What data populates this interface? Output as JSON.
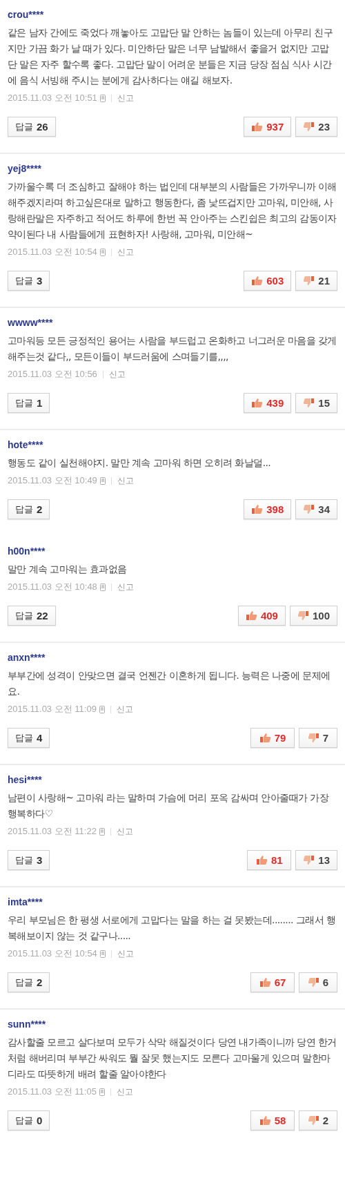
{
  "comments": [
    {
      "user": "crou****",
      "text": "같은 남자 간에도 죽었다 깨놓아도 고맙단 말 안하는 놈들이 있는데 아무리 친구지만 가끔 화가 날 때가 있다. 미안하단 말은 너무 남발해서 좋을거 없지만 고맙단 말은 자주 할수록 좋다. 고맙단 말이 어려운 분들은 지금 당장 점심 식사 시간에 음식 서빙해 주시는 분에게 감사하다는 얘길 해보자.",
      "date": "2015.11.03 오전 10:51",
      "mobile": true,
      "report": "신고",
      "reply_label": "답글",
      "reply_count": "26",
      "likes": "937",
      "dislikes": "23",
      "divider": true
    },
    {
      "user": "yej8****",
      "text": "가까울수록 더 조심하고 잘해야 하는 법인데 대부분의 사람들은 가까우니까 이해해주겠지라며 하고싶은대로 말하고 행동한다, 좀 낯뜨겁지만 고마워, 미안해, 사랑해란말은 자주하고 적어도 하루에 한번 꼭 안아주는 스킨쉽은 최고의 감동이자 약이된다 내 사람들에게 표현하자! 사랑해, 고마워, 미안해~",
      "date": "2015.11.03 오전 10:54",
      "mobile": true,
      "report": "신고",
      "reply_label": "답글",
      "reply_count": "3",
      "likes": "603",
      "dislikes": "21",
      "divider": true
    },
    {
      "user": "wwww****",
      "text": "고마워등 모든 긍정적인 용어는 사람을 부드럽고 온화하고 너그러운 마음을 갖게 해주는것 같다,, 모든이들이 부드러움에 스며들기를,,,,",
      "date": "2015.11.03 오전 10:56",
      "mobile": false,
      "report": "신고",
      "reply_label": "답글",
      "reply_count": "1",
      "likes": "439",
      "dislikes": "15",
      "divider": true
    },
    {
      "user": "hote****",
      "text": "행동도 같이 실천해야지. 말만 계속 고마워 하면 오히려 화날덜...",
      "date": "2015.11.03 오전 10:49",
      "mobile": true,
      "report": "신고",
      "reply_label": "답글",
      "reply_count": "2",
      "likes": "398",
      "dislikes": "34",
      "divider": false
    },
    {
      "user": "h00n****",
      "text": "말만 계속 고마워는 효과없음",
      "date": "2015.11.03 오전 10:48",
      "mobile": true,
      "report": "신고",
      "reply_label": "답글",
      "reply_count": "22",
      "likes": "409",
      "dislikes": "100",
      "divider": true
    },
    {
      "user": "anxn****",
      "text": "부부간에 성격이 안맞으면 결국 언젠간 이혼하게 됩니다. 능력은 나중에 문제에요.",
      "date": "2015.11.03 오전 11:09",
      "mobile": true,
      "report": "신고",
      "reply_label": "답글",
      "reply_count": "4",
      "likes": "79",
      "dislikes": "7",
      "divider": true
    },
    {
      "user": "hesi****",
      "text": "남편이 사랑해~ 고마워 라는 말하며 가슴에 머리 포옥 감싸며 안아줄때가 가장 행복하다♡",
      "date": "2015.11.03 오전 11:22",
      "mobile": true,
      "report": "신고",
      "reply_label": "답글",
      "reply_count": "3",
      "likes": "81",
      "dislikes": "13",
      "divider": true
    },
    {
      "user": "imta****",
      "text": "우리 부모님은 한 평생 서로에게 고맙다는 말을 하는 걸 못봤는데........ 그래서 행복해보이지 않는 것 같구나.....",
      "date": "2015.11.03 오전 10:54",
      "mobile": true,
      "report": "신고",
      "reply_label": "답글",
      "reply_count": "2",
      "likes": "67",
      "dislikes": "6",
      "divider": true
    },
    {
      "user": "sunn****",
      "text": "감사할줄 모르고 살다보며 모두가 삭막 해질것이다 당연 내가족이니까 당연 한거처럼 해버리며 부부간 싸워도 뭘 잘못 했는지도 모른다 고마울게 있으며 말한마디라도 따뜻하게 배려 할줄 알아야한다",
      "date": "2015.11.03 오전 11:05",
      "mobile": true,
      "report": "신고",
      "reply_label": "답글",
      "reply_count": "0",
      "likes": "58",
      "dislikes": "2",
      "divider": false
    }
  ]
}
